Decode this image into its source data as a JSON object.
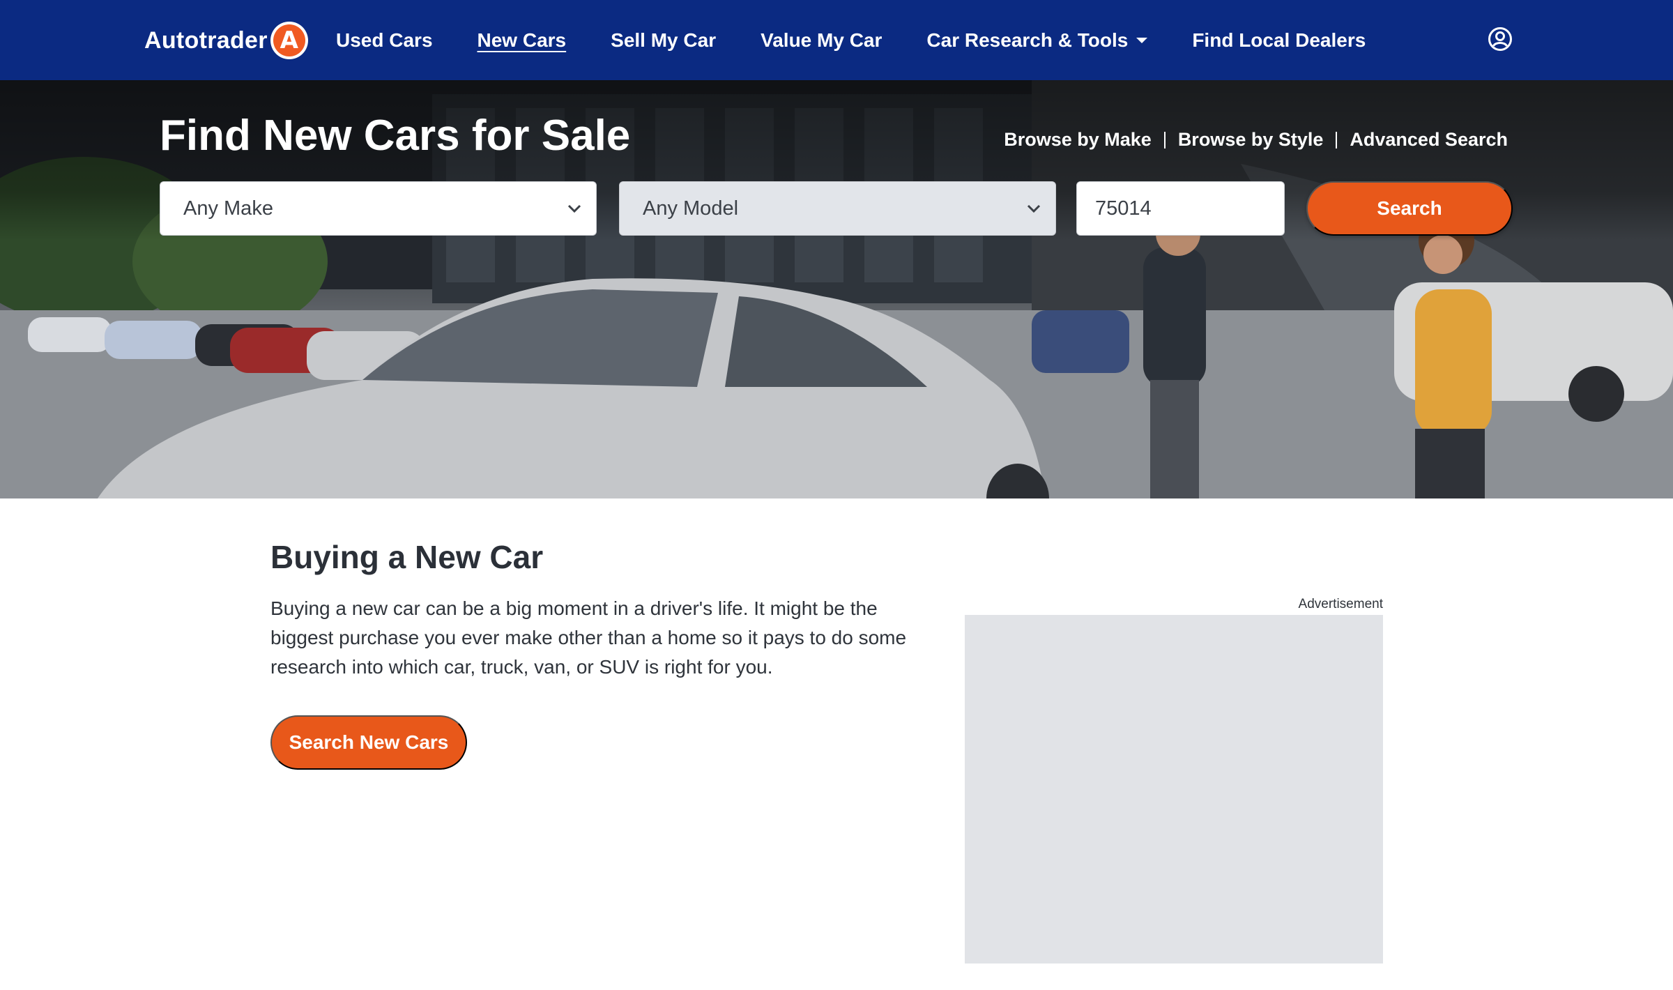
{
  "brand": {
    "name": "Autotrader",
    "badge_letter": "A",
    "accent": "#f05a22",
    "nav_bg": "#0b2a82"
  },
  "nav": {
    "items": [
      {
        "label": "Used Cars",
        "active": false
      },
      {
        "label": "New Cars",
        "active": true
      },
      {
        "label": "Sell My Car",
        "active": false
      },
      {
        "label": "Value My Car",
        "active": false
      },
      {
        "label": "Car Research & Tools",
        "active": false,
        "dropdown": true
      },
      {
        "label": "Find Local Dealers",
        "active": false
      }
    ],
    "account_icon": "user-circle-icon"
  },
  "hero": {
    "title": "Find New Cars for Sale",
    "links": [
      "Browse by Make",
      "Browse by Style",
      "Advanced Search"
    ],
    "make_select": "Any Make",
    "model_select": "Any Model",
    "zip_value": "75014",
    "search_label": "Search"
  },
  "content": {
    "title": "Buying a New Car",
    "body": "Buying a new car can be a big moment in a driver's life. It might be the biggest purchase you ever make other than a home so it pays to do some research into which car, truck, van, or SUV is right for you.",
    "cta_label": "Search New Cars"
  },
  "ad": {
    "label": "Advertisement"
  },
  "colors": {
    "cta": "#e8581a",
    "ad_placeholder": "#e1e3e7"
  }
}
